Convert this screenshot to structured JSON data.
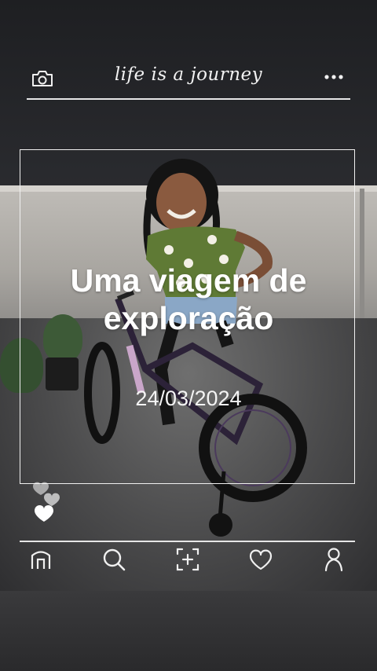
{
  "header": {
    "title": "life is a journey",
    "left_icon": "camera-icon",
    "right_icon": "more-dots-icon"
  },
  "card": {
    "headline_line1": "Uma viagem de",
    "headline_line2": "exploração",
    "date": "24/03/2024"
  },
  "decor": {
    "hearts_icon": "hearts-icon"
  },
  "bottom_nav": {
    "items": [
      {
        "icon": "home-icon"
      },
      {
        "icon": "search-icon"
      },
      {
        "icon": "add-photo-icon"
      },
      {
        "icon": "heart-icon"
      },
      {
        "icon": "profile-icon"
      }
    ]
  },
  "colors": {
    "overlay_line": "#e6e6e6",
    "text": "#ffffff"
  }
}
